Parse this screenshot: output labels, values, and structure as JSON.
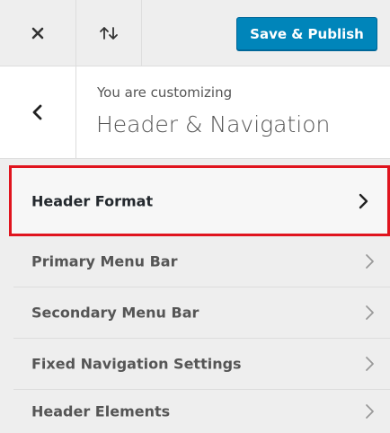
{
  "topbar": {
    "close_icon": "close-icon",
    "reorder_icon": "sort-arrows-icon",
    "save_label": "Save & Publish",
    "accent_color": "#0085ba"
  },
  "section": {
    "back_icon": "chevron-left-icon",
    "customizing_label": "You are customizing",
    "title": "Header & Navigation"
  },
  "menu": {
    "items": [
      {
        "label": "Header Format",
        "selected": true
      },
      {
        "label": "Primary Menu Bar",
        "selected": false
      },
      {
        "label": "Secondary Menu Bar",
        "selected": false
      },
      {
        "label": "Fixed Navigation Settings",
        "selected": false
      },
      {
        "label": "Header Elements",
        "selected": false
      }
    ],
    "highlight_color": "#e0141e"
  }
}
